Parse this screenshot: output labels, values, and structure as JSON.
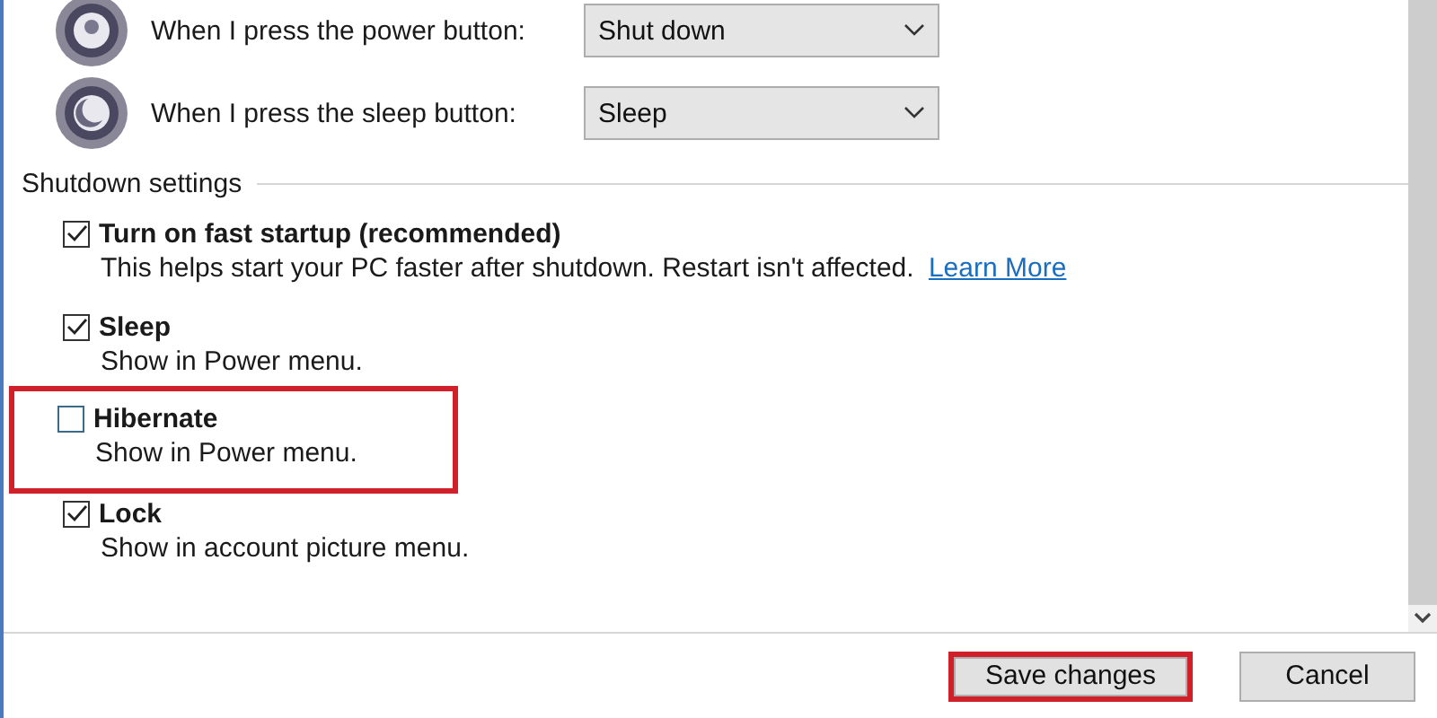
{
  "button_actions": [
    {
      "label": "When I press the power button:",
      "value": "Shut down",
      "kind": "power"
    },
    {
      "label": "When I press the sleep button:",
      "value": "Sleep",
      "kind": "sleep"
    }
  ],
  "shutdown_settings": {
    "title": "Shutdown settings",
    "options": [
      {
        "label": "Turn on fast startup (recommended)",
        "description": "This helps start your PC faster after shutdown. Restart isn't affected.",
        "link": "Learn More",
        "checked": true,
        "highlighted": false
      },
      {
        "label": "Sleep",
        "description": "Show in Power menu.",
        "checked": true,
        "highlighted": false
      },
      {
        "label": "Hibernate",
        "description": "Show in Power menu.",
        "checked": false,
        "highlighted": true
      },
      {
        "label": "Lock",
        "description": "Show in account picture menu.",
        "checked": true,
        "highlighted": false
      }
    ]
  },
  "buttons": [
    {
      "label": "Save changes",
      "highlighted": true
    },
    {
      "label": "Cancel",
      "highlighted": false
    }
  ]
}
